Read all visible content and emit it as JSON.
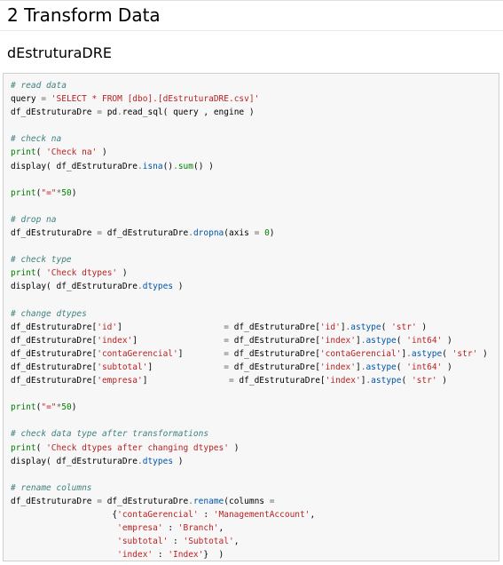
{
  "page": {
    "title": "2 Transform Data",
    "section": "dEstruturaDRE"
  },
  "colors": {
    "comment": "#408080",
    "string": "#ba2121",
    "number": "#008000",
    "builtin": "#008000",
    "operator": "#666666",
    "attribute": "#0055aa",
    "cell_background": "#f7f7f7",
    "cell_border": "#cfcfcf"
  },
  "code_lines": [
    [
      [
        "comment",
        "# read data"
      ]
    ],
    [
      [
        "plain",
        "query "
      ],
      [
        "op",
        "="
      ],
      [
        "plain",
        " "
      ],
      [
        "string",
        "'SELECT * FROM [dbo].[dEstruturaDRE.csv]'"
      ]
    ],
    [
      [
        "plain",
        "df_dEstruturaDre "
      ],
      [
        "op",
        "="
      ],
      [
        "plain",
        " pd"
      ],
      [
        "op",
        "."
      ],
      [
        "plain",
        "read_sql( query , engine )"
      ]
    ],
    [],
    [
      [
        "comment",
        "# check na"
      ]
    ],
    [
      [
        "builtin",
        "print"
      ],
      [
        "plain",
        "( "
      ],
      [
        "string",
        "'Check na'"
      ],
      [
        "plain",
        " )"
      ]
    ],
    [
      [
        "plain",
        "display( df_dEstruturaDre"
      ],
      [
        "op",
        "."
      ],
      [
        "attr",
        "isna"
      ],
      [
        "plain",
        "()"
      ],
      [
        "op",
        "."
      ],
      [
        "builtin",
        "sum"
      ],
      [
        "plain",
        "() )"
      ]
    ],
    [],
    [
      [
        "builtin",
        "print"
      ],
      [
        "plain",
        "("
      ],
      [
        "string",
        "\"=\""
      ],
      [
        "op",
        "*"
      ],
      [
        "number",
        "50"
      ],
      [
        "plain",
        ")"
      ]
    ],
    [],
    [
      [
        "comment",
        "# drop na"
      ]
    ],
    [
      [
        "plain",
        "df_dEstruturaDre "
      ],
      [
        "op",
        "="
      ],
      [
        "plain",
        " df_dEstruturaDre"
      ],
      [
        "op",
        "."
      ],
      [
        "attr",
        "dropna"
      ],
      [
        "plain",
        "(axis "
      ],
      [
        "op",
        "="
      ],
      [
        "plain",
        " "
      ],
      [
        "number",
        "0"
      ],
      [
        "plain",
        ")"
      ]
    ],
    [],
    [
      [
        "comment",
        "# check type"
      ]
    ],
    [
      [
        "builtin",
        "print"
      ],
      [
        "plain",
        "( "
      ],
      [
        "string",
        "'Check dtypes'"
      ],
      [
        "plain",
        " )"
      ]
    ],
    [
      [
        "plain",
        "display( df_dEstruturaDre"
      ],
      [
        "op",
        "."
      ],
      [
        "attr",
        "dtypes"
      ],
      [
        "plain",
        " )"
      ]
    ],
    [],
    [
      [
        "comment",
        "# change dtypes"
      ]
    ],
    [
      [
        "plain",
        "df_dEstruturaDre["
      ],
      [
        "string",
        "'id'"
      ],
      [
        "plain",
        "]                    "
      ],
      [
        "op",
        "="
      ],
      [
        "plain",
        " df_dEstruturaDre["
      ],
      [
        "string",
        "'id'"
      ],
      [
        "plain",
        "]"
      ],
      [
        "op",
        "."
      ],
      [
        "attr",
        "astype"
      ],
      [
        "plain",
        "( "
      ],
      [
        "string",
        "'str'"
      ],
      [
        "plain",
        " )"
      ]
    ],
    [
      [
        "plain",
        "df_dEstruturaDre["
      ],
      [
        "string",
        "'index'"
      ],
      [
        "plain",
        "]                 "
      ],
      [
        "op",
        "="
      ],
      [
        "plain",
        " df_dEstruturaDre["
      ],
      [
        "string",
        "'index'"
      ],
      [
        "plain",
        "]"
      ],
      [
        "op",
        "."
      ],
      [
        "attr",
        "astype"
      ],
      [
        "plain",
        "( "
      ],
      [
        "string",
        "'int64'"
      ],
      [
        "plain",
        " )"
      ]
    ],
    [
      [
        "plain",
        "df_dEstruturaDre["
      ],
      [
        "string",
        "'contaGerencial'"
      ],
      [
        "plain",
        "]        "
      ],
      [
        "op",
        "="
      ],
      [
        "plain",
        " df_dEstruturaDre["
      ],
      [
        "string",
        "'contaGerencial'"
      ],
      [
        "plain",
        "]"
      ],
      [
        "op",
        "."
      ],
      [
        "attr",
        "astype"
      ],
      [
        "plain",
        "( "
      ],
      [
        "string",
        "'str'"
      ],
      [
        "plain",
        " )"
      ]
    ],
    [
      [
        "plain",
        "df_dEstruturaDre["
      ],
      [
        "string",
        "'subtotal'"
      ],
      [
        "plain",
        "]              "
      ],
      [
        "op",
        "="
      ],
      [
        "plain",
        " df_dEstruturaDre["
      ],
      [
        "string",
        "'index'"
      ],
      [
        "plain",
        "]"
      ],
      [
        "op",
        "."
      ],
      [
        "attr",
        "astype"
      ],
      [
        "plain",
        "( "
      ],
      [
        "string",
        "'int64'"
      ],
      [
        "plain",
        " )"
      ]
    ],
    [
      [
        "plain",
        "df_dEstruturaDre["
      ],
      [
        "string",
        "'empresa'"
      ],
      [
        "plain",
        "]                "
      ],
      [
        "op",
        "="
      ],
      [
        "plain",
        " df_dEstruturaDre["
      ],
      [
        "string",
        "'index'"
      ],
      [
        "plain",
        "]"
      ],
      [
        "op",
        "."
      ],
      [
        "attr",
        "astype"
      ],
      [
        "plain",
        "( "
      ],
      [
        "string",
        "'str'"
      ],
      [
        "plain",
        " )"
      ]
    ],
    [],
    [
      [
        "builtin",
        "print"
      ],
      [
        "plain",
        "("
      ],
      [
        "string",
        "\"=\""
      ],
      [
        "op",
        "*"
      ],
      [
        "number",
        "50"
      ],
      [
        "plain",
        ")"
      ]
    ],
    [],
    [
      [
        "comment",
        "# check data type after transformations"
      ]
    ],
    [
      [
        "builtin",
        "print"
      ],
      [
        "plain",
        "( "
      ],
      [
        "string",
        "'Check dtypes after changing dtypes'"
      ],
      [
        "plain",
        " )"
      ]
    ],
    [
      [
        "plain",
        "display( df_dEstruturaDre"
      ],
      [
        "op",
        "."
      ],
      [
        "attr",
        "dtypes"
      ],
      [
        "plain",
        " )"
      ]
    ],
    [],
    [
      [
        "comment",
        "# rename columns"
      ]
    ],
    [
      [
        "plain",
        "df_dEstruturaDre "
      ],
      [
        "op",
        "="
      ],
      [
        "plain",
        " df_dEstruturaDre"
      ],
      [
        "op",
        "."
      ],
      [
        "attr",
        "rename"
      ],
      [
        "plain",
        "(columns "
      ],
      [
        "op",
        "="
      ]
    ],
    [
      [
        "plain",
        "                    {"
      ],
      [
        "string",
        "'contaGerencial'"
      ],
      [
        "plain",
        " : "
      ],
      [
        "string",
        "'ManagementAccount'"
      ],
      [
        "plain",
        ","
      ]
    ],
    [
      [
        "plain",
        "                     "
      ],
      [
        "string",
        "'empresa'"
      ],
      [
        "plain",
        " : "
      ],
      [
        "string",
        "'Branch'"
      ],
      [
        "plain",
        ","
      ]
    ],
    [
      [
        "plain",
        "                     "
      ],
      [
        "string",
        "'subtotal'"
      ],
      [
        "plain",
        " : "
      ],
      [
        "string",
        "'Subtotal'"
      ],
      [
        "plain",
        ","
      ]
    ],
    [
      [
        "plain",
        "                     "
      ],
      [
        "string",
        "'index'"
      ],
      [
        "plain",
        " : "
      ],
      [
        "string",
        "'Index'"
      ],
      [
        "plain",
        "}  )"
      ]
    ]
  ]
}
